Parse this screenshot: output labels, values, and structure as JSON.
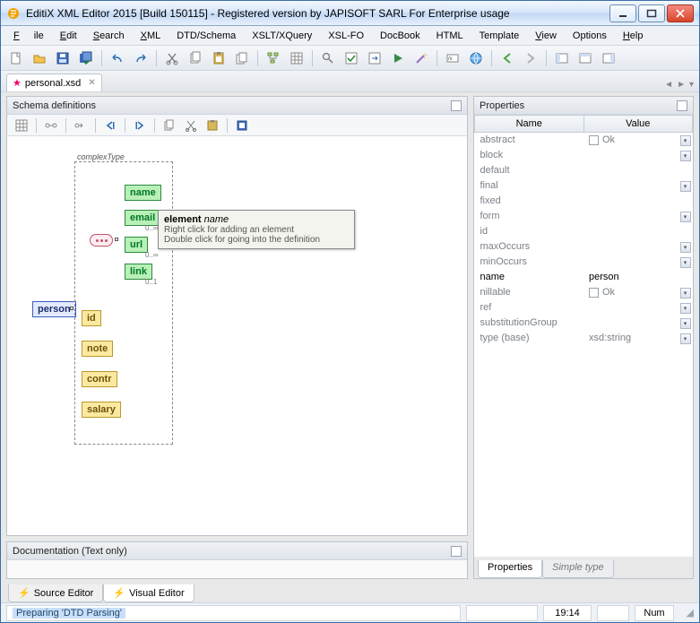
{
  "window": {
    "title": "EditiX XML Editor 2015 [Build 150115] - Registered version by JAPISOFT SARL For Enterprise usage"
  },
  "menu": {
    "file": "File",
    "edit": "Edit",
    "search": "Search",
    "xml": "XML",
    "dtd": "DTD/Schema",
    "xslt": "XSLT/XQuery",
    "xslfo": "XSL-FO",
    "docbook": "DocBook",
    "html": "HTML",
    "template": "Template",
    "view": "View",
    "options": "Options",
    "help": "Help"
  },
  "tab": {
    "filename": "personal.xsd"
  },
  "schema_panel": {
    "title": "Schema definitions",
    "complexType": "complexType",
    "root": "person",
    "elements_green": [
      "name",
      "email",
      "url",
      "link"
    ],
    "elements_yellow": [
      "id",
      "note",
      "contr",
      "salary"
    ],
    "occ": {
      "email": "0..∞",
      "url": "0..∞",
      "link": "0..1"
    },
    "tooltip": {
      "title_prefix": "element ",
      "title_em": "name",
      "line1": "Right click for adding an element",
      "line2": "Double click for going into the definition"
    }
  },
  "doc_panel": {
    "title": "Documentation (Text only)"
  },
  "properties": {
    "title": "Properties",
    "headers": {
      "name": "Name",
      "value": "Value"
    },
    "rows": [
      {
        "name": "abstract",
        "value": "Ok",
        "check": true,
        "dd": true
      },
      {
        "name": "block",
        "value": "",
        "dd": true
      },
      {
        "name": "default",
        "value": ""
      },
      {
        "name": "final",
        "value": "",
        "dd": true
      },
      {
        "name": "fixed",
        "value": ""
      },
      {
        "name": "form",
        "value": "",
        "dd": true
      },
      {
        "name": "id",
        "value": ""
      },
      {
        "name": "maxOccurs",
        "value": "",
        "dd": true
      },
      {
        "name": "minOccurs",
        "value": "",
        "dd": true
      },
      {
        "name": "name",
        "value": "person",
        "strong": true
      },
      {
        "name": "nillable",
        "value": "Ok",
        "check": true,
        "dd": true
      },
      {
        "name": "ref",
        "value": "",
        "dd": true
      },
      {
        "name": "substitutionGroup",
        "value": "",
        "dd": true
      },
      {
        "name": "type (base)",
        "value": "xsd:string",
        "dd": true
      }
    ],
    "tabs": {
      "properties": "Properties",
      "simple": "Simple type"
    }
  },
  "bottom_tabs": {
    "source": "Source Editor",
    "visual": "Visual Editor"
  },
  "status": {
    "msg": "Preparing 'DTD Parsing'",
    "time": "19:14",
    "num": "Num"
  }
}
